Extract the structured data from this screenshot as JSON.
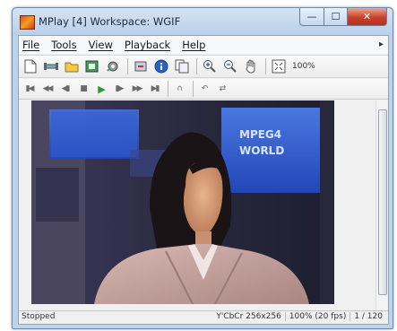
{
  "window": {
    "title": "MPlay [4]   Workspace: WGIF",
    "caption": {
      "minimize": "—",
      "maximize": "☐",
      "close": "✕"
    }
  },
  "menu": {
    "items": [
      "File",
      "Tools",
      "View",
      "Playback",
      "Help"
    ],
    "pin": "▸"
  },
  "toolbar": {
    "zoom_label": "100%",
    "icons": [
      "new-icon",
      "link-icon",
      "open-folder-icon",
      "export-icon",
      "settings-icon",
      "loop-icon",
      "info-icon",
      "copy-icon",
      "zoom-in-icon",
      "zoom-out-icon",
      "pan-icon",
      "fit-window-icon"
    ]
  },
  "playback": {
    "icons": [
      "first-frame-icon",
      "rewind-icon",
      "step-back-icon",
      "stop-icon",
      "play-icon",
      "step-forward-icon",
      "fast-forward-icon",
      "last-frame-icon",
      "loop-icon",
      "drive-icon"
    ]
  },
  "video": {
    "sign_line1": "MPEG4",
    "sign_line2": "WORLD"
  },
  "status": {
    "state": "Stopped",
    "frame_info": "Y'CbCr 256x256",
    "zoom_fps": "100% (20 fps)",
    "frame_counter": "1 / 120"
  },
  "colors": {
    "titlebar": "#c9dcf1",
    "play_green": "#2a9a2a",
    "close_red": "#c8402a"
  }
}
